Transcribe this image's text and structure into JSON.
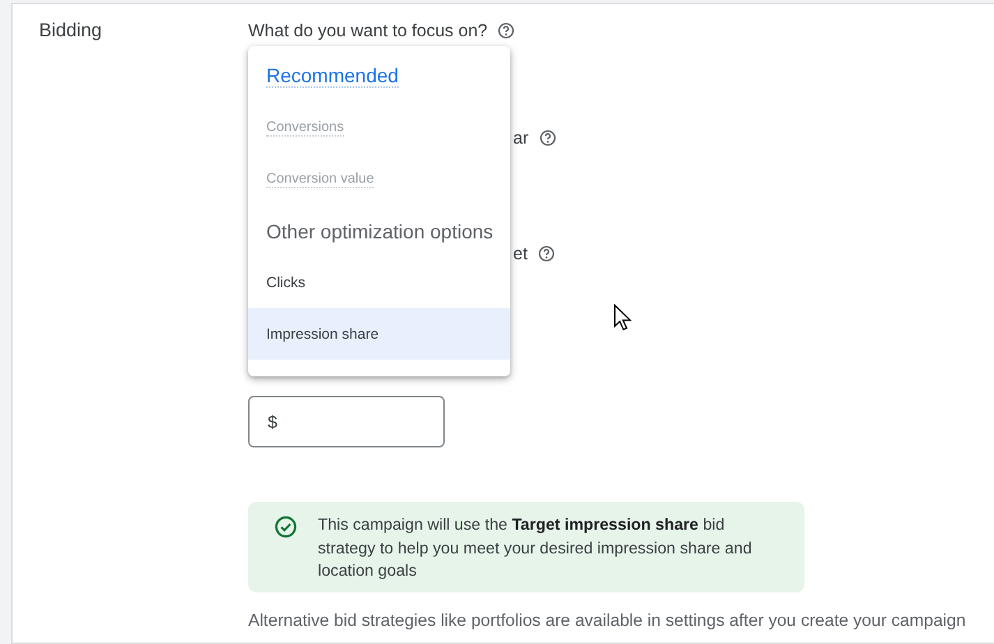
{
  "section_title": "Bidding",
  "question": {
    "label": "What do you want to focus on?"
  },
  "menu": {
    "groups": [
      {
        "title": "Recommended",
        "highlighted": true,
        "items": [
          {
            "label": "Conversions",
            "disabled": true,
            "selected": false
          },
          {
            "label": "Conversion value",
            "disabled": true,
            "selected": false
          }
        ]
      },
      {
        "title": "Other optimization options",
        "highlighted": false,
        "items": [
          {
            "label": "Clicks",
            "disabled": false,
            "selected": false
          },
          {
            "label": "Impression share",
            "disabled": false,
            "selected": true
          }
        ]
      }
    ]
  },
  "covered_labels": [
    "ar",
    "et"
  ],
  "bid_limit": {
    "prefix": "$"
  },
  "notice": {
    "text": "This campaign will use the **Target impression share** bid strategy to help you meet your desired impression share and location goals"
  },
  "footnote": "Alternative bid strategies like portfolios are available in settings after you create your campaign"
}
